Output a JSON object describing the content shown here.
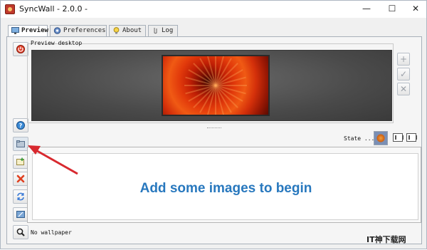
{
  "window": {
    "title": "SyncWall - 2.0.0 -",
    "minimize_glyph": "—",
    "maximize_glyph": "☐",
    "close_glyph": "✕"
  },
  "tabs": [
    {
      "label": "Preview",
      "icon": "monitor-icon",
      "active": true
    },
    {
      "label": "Preferences",
      "icon": "gear-icon",
      "active": false
    },
    {
      "label": "About",
      "icon": "lightbulb-icon",
      "active": false
    },
    {
      "label": "Log",
      "icon": "clip-icon",
      "active": false
    }
  ],
  "preview": {
    "group_label": "Preview desktop"
  },
  "state": {
    "label": "State ..."
  },
  "list": {
    "empty_message": "Add some images to begin"
  },
  "status": {
    "text": "No wallpaper"
  },
  "watermark": {
    "text": "IT神下载网"
  },
  "colors": {
    "accent_blue": "#2878be",
    "arrow_red": "#d8292f",
    "power_red": "#e0402a"
  }
}
